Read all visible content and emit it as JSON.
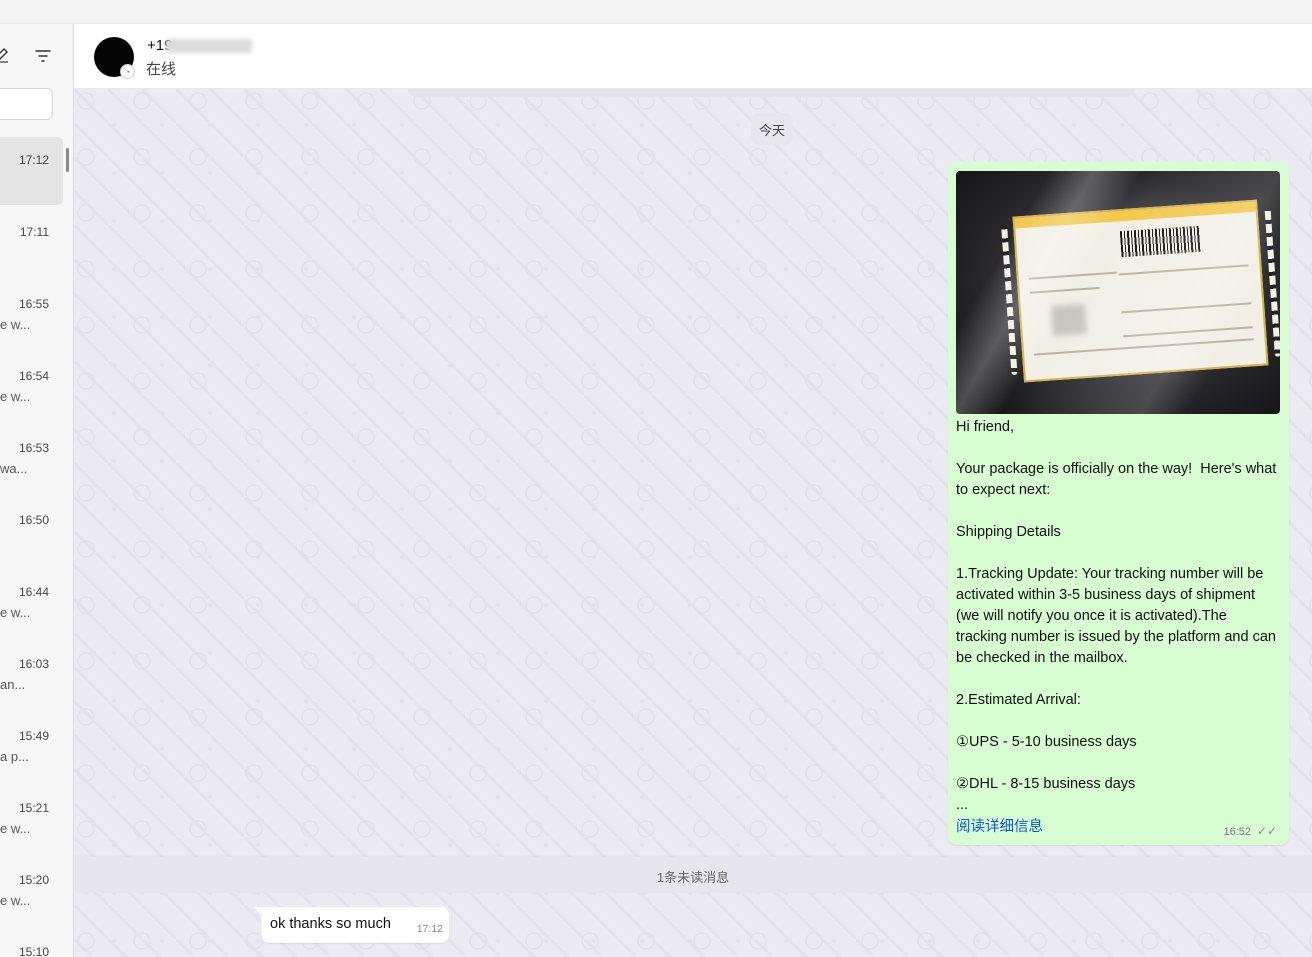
{
  "sidebar": {
    "chats": [
      {
        "time": "17:12",
        "preview": "",
        "active": true
      },
      {
        "time": "17:11",
        "preview": ""
      },
      {
        "time": "16:55",
        "preview": "e w..."
      },
      {
        "time": "16:54",
        "preview": "e w..."
      },
      {
        "time": "16:53",
        "preview": "wa..."
      },
      {
        "time": "16:50",
        "preview": ""
      },
      {
        "time": "16:44",
        "preview": "e w..."
      },
      {
        "time": "16:03",
        "preview": "an..."
      },
      {
        "time": "15:49",
        "preview": "a p..."
      },
      {
        "time": "15:21",
        "preview": "e w..."
      },
      {
        "time": "15:20",
        "preview": "e w..."
      },
      {
        "time": "15:10",
        "preview": ""
      }
    ]
  },
  "header": {
    "contact_name": "+19",
    "status": "在线"
  },
  "chat": {
    "date_divider": "今天",
    "outgoing": {
      "text": "Hi friend,\n\nYour package is officially on the way!  Here's what to expect next:\n\nShipping Details\n\n1.Tracking Update: Your tracking number will be activated within 3-5 business days of shipment (we will notify you once it is activated).The tracking number is issued by the platform and can be checked in the mailbox.\n\n2.Estimated Arrival:\n\n①UPS - 5-10 business days\n\n②DHL - 8-15 business days\n...",
      "read_more": "阅读详细信息",
      "time": "16:52",
      "status_icon": "double-check-icon"
    },
    "unread_divider": "1条未读消息",
    "incoming": {
      "text": "ok thanks so much",
      "time": "17:12"
    }
  },
  "colors": {
    "outgoing_bubble": "#d9fdd3",
    "incoming_bubble": "#ffffff",
    "chat_background": "#eceaf2",
    "link": "#0a58ca"
  }
}
